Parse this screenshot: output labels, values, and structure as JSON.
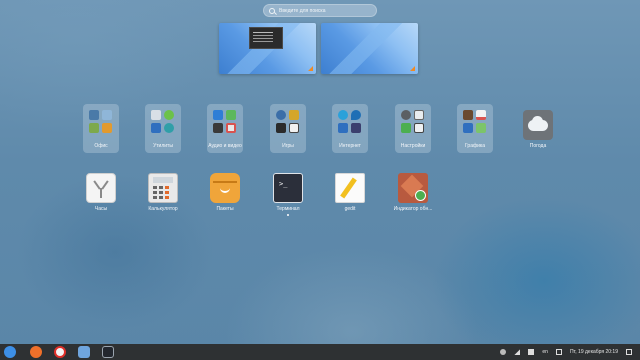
{
  "search": {
    "placeholder": "Введите для поиска"
  },
  "folders": [
    {
      "label": "Офис"
    },
    {
      "label": "Утилиты"
    },
    {
      "label": "Аудио и видео"
    },
    {
      "label": "Игры"
    },
    {
      "label": "Интернет"
    },
    {
      "label": "Настройки"
    },
    {
      "label": "Графика"
    }
  ],
  "apps_row1": [
    {
      "label": "Погода"
    }
  ],
  "apps_row2": [
    {
      "label": "Часы"
    },
    {
      "label": "Калькулятор"
    },
    {
      "label": "Пакеты"
    },
    {
      "label": "Терминал"
    },
    {
      "label": "gedit"
    },
    {
      "label": "Индикатор обн..."
    }
  ],
  "taskbar": {
    "keyboard_layout": "en",
    "datetime": "Пт, 19 декабря  20:19"
  },
  "colors": {
    "taskbar": "#2e3133",
    "accent": "#f08a24"
  }
}
